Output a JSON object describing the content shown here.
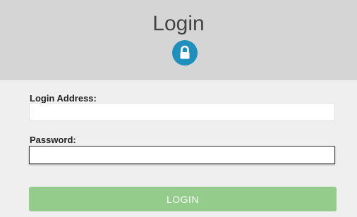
{
  "header": {
    "title": "Login",
    "icon": "lock-icon",
    "icon_color": "#1f8fbc",
    "background": "#d5d5d5"
  },
  "form": {
    "email_label": "Login Address:",
    "email_value": "",
    "password_label": "Password:",
    "password_value": "",
    "submit_label": "LOGIN",
    "submit_color": "#94cc8c",
    "background": "#efefef"
  }
}
